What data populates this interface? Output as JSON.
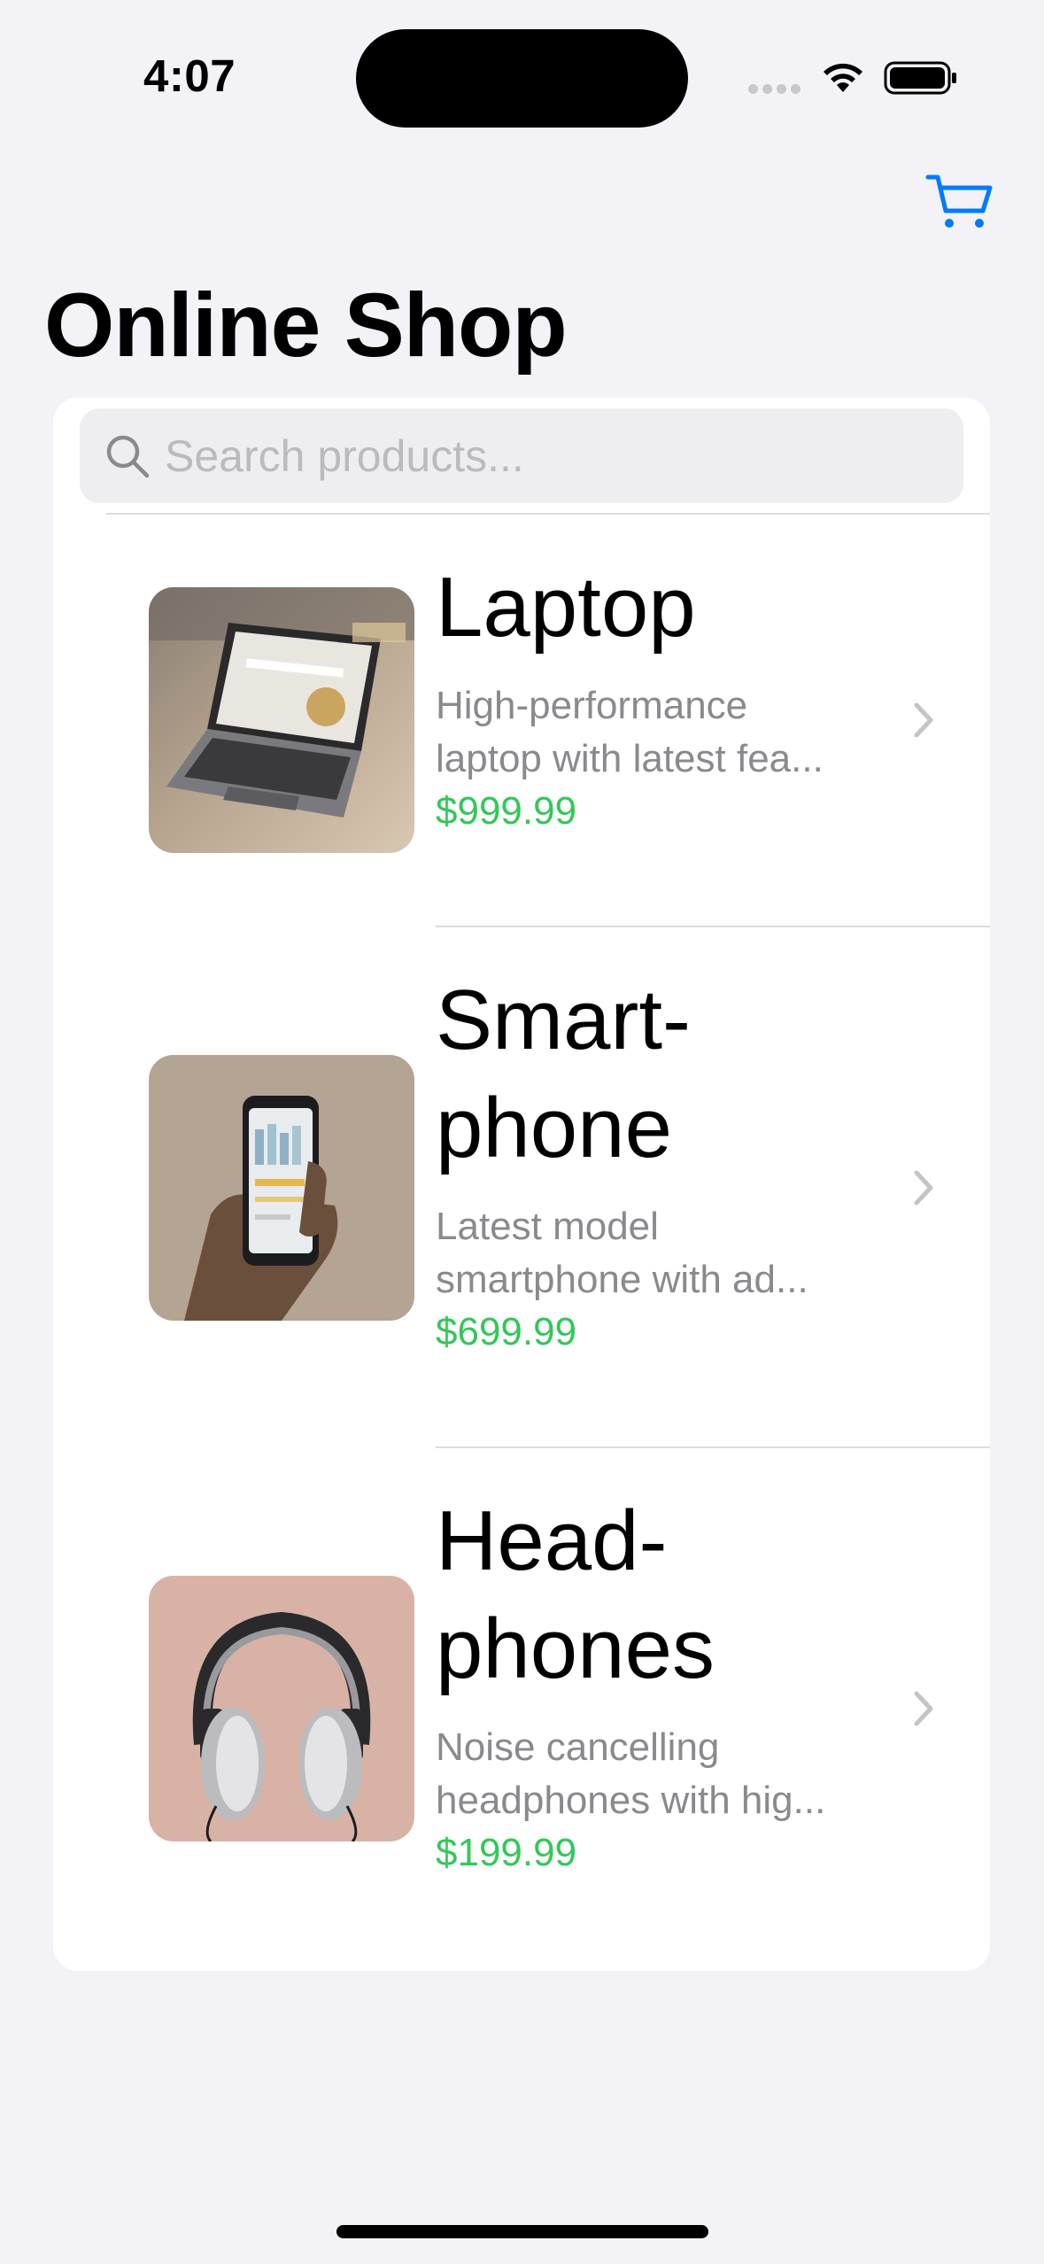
{
  "status_bar": {
    "time": "4:07"
  },
  "header": {
    "title": "Online Shop",
    "cart_icon": "cart-icon",
    "accent_color": "#007AFF"
  },
  "search": {
    "placeholder": "Search products...",
    "value": ""
  },
  "products": [
    {
      "name": "Laptop",
      "description": "High-performance\nlaptop with latest fea...",
      "price": "$999.99",
      "image": "laptop-photo"
    },
    {
      "name": "Smart-\nphone",
      "description": "Latest model\nsmartphone with ad...",
      "price": "$699.99",
      "image": "smartphone-photo"
    },
    {
      "name": "Head-\nphones",
      "description": "Noise cancelling\nheadphones with hig...",
      "price": "$199.99",
      "image": "headphones-photo"
    }
  ],
  "colors": {
    "price": "#34C759",
    "background": "#F2F2F7",
    "secondary_text": "#8A8A8E"
  }
}
